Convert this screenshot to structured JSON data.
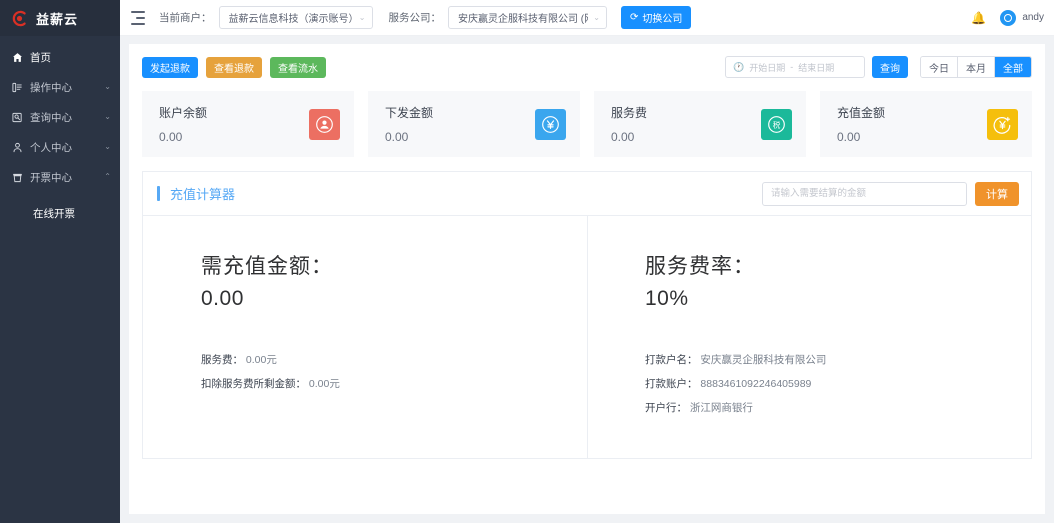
{
  "sidebar": {
    "logo_text": "益薪云",
    "logo_icon": "brand-circle-icon",
    "items": [
      {
        "label": "首页",
        "icon": "home-icon",
        "caret": "",
        "active": true
      },
      {
        "label": "操作中心",
        "icon": "operations-icon",
        "caret": "⌄"
      },
      {
        "label": "查询中心",
        "icon": "search-center-icon",
        "caret": "⌄"
      },
      {
        "label": "个人中心",
        "icon": "user-icon",
        "caret": "⌄"
      },
      {
        "label": "开票中心",
        "icon": "invoice-icon",
        "caret": "⌃"
      }
    ],
    "submenu": [
      {
        "label": "在线开票"
      }
    ]
  },
  "topbar": {
    "collapse_icon": "menu-collapse-icon",
    "merchant_label": "当前商户：",
    "merchant_value": "益薪云信息科技（演示账号）",
    "company_label": "服务公司：",
    "company_value": "安庆赢灵企服科技有限公司 (网商银行",
    "switch_button": "切换公司",
    "switch_icon": "refresh-icon",
    "bell_icon": "bell-icon",
    "avatar_icon": "avatar-icon",
    "username": "andy"
  },
  "toolbar": {
    "buttons": [
      {
        "label": "发起退款",
        "color": "#1890ff"
      },
      {
        "label": "查看退款",
        "color": "#e6a23c"
      },
      {
        "label": "查看流水",
        "color": "#5cb85c"
      }
    ],
    "date_icon": "clock-icon",
    "start_date_placeholder": "开始日期",
    "date_separator": "-",
    "end_date_placeholder": "结束日期",
    "search_button": "查询",
    "segments": [
      {
        "label": "今日",
        "active": false
      },
      {
        "label": "本月",
        "active": false
      },
      {
        "label": "全部",
        "active": true
      }
    ]
  },
  "stats": [
    {
      "title": "账户余额",
      "value": "0.00",
      "icon": "account-balance-icon",
      "color": "#ec6f62"
    },
    {
      "title": "下发金额",
      "value": "0.00",
      "icon": "payout-yuan-icon",
      "color": "#3aa6ee"
    },
    {
      "title": "服务费",
      "value": "0.00",
      "icon": "service-fee-tax-icon",
      "color": "#1bb99a"
    },
    {
      "title": "充值金额",
      "value": "0.00",
      "icon": "recharge-yuan-plus-icon",
      "color": "#f5bf0c"
    }
  ],
  "calculator": {
    "title": "充值计算器",
    "input_placeholder": "请输入需要结算的金额",
    "input_value": "",
    "calc_button": "计算",
    "left": {
      "label": "需充值金额：",
      "value": "0.00",
      "rows": [
        {
          "label": "服务费：",
          "value": "0.00元"
        },
        {
          "label": "扣除服务费所剩金额：",
          "value": "0.00元"
        }
      ]
    },
    "right": {
      "label": "服务费率：",
      "value": "10%",
      "rows": [
        {
          "label": "打款户名：",
          "value": "安庆赢灵企服科技有限公司"
        },
        {
          "label": "打款账户：",
          "value": "8883461092246405989"
        },
        {
          "label": "开户行：",
          "value": "浙江网商银行"
        }
      ]
    }
  }
}
